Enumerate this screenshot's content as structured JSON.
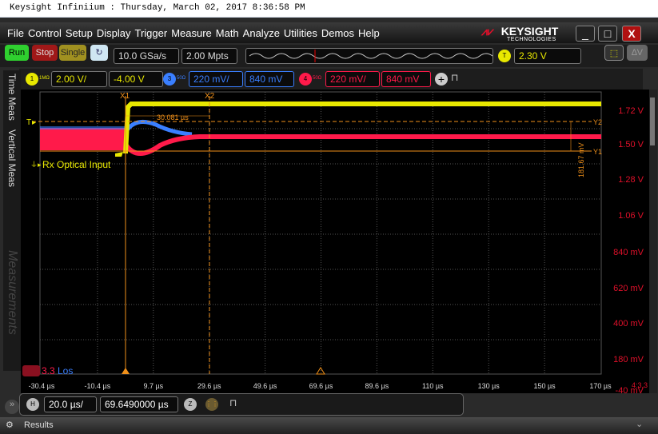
{
  "window_title": "Keysight Infiniium : Thursday, March 02, 2017 8:36:58 PM",
  "menu": [
    "File",
    "Control",
    "Setup",
    "Display",
    "Trigger",
    "Measure",
    "Math",
    "Analyze",
    "Utilities",
    "Demos",
    "Help"
  ],
  "logo": {
    "name": "KEYSIGHT",
    "sub": "TECHNOLOGIES"
  },
  "toolbar": {
    "run": "Run",
    "stop": "Stop",
    "single": "Single",
    "sample_rate": "10.0 GSa/s",
    "memory_depth": "2.00 Mpts",
    "trigger_label": "T",
    "trigger_level": "2.30 V"
  },
  "channels": [
    {
      "num": "1",
      "imp": "1MΩ",
      "scale": "2.00 V/",
      "offset": "-4.00 V",
      "color": "#e8e800"
    },
    {
      "num": "3",
      "imp": "50Ω",
      "scale": "220 mV/",
      "offset": "840 mV",
      "color": "#3a7fff"
    },
    {
      "num": "4",
      "imp": "50Ω",
      "scale": "220 mV/",
      "offset": "840 mV",
      "color": "#ff1a4a"
    }
  ],
  "side_tabs": [
    "Time Meas",
    "Vertical Meas",
    "Measurements"
  ],
  "waveform": {
    "y_labels": [
      "1.72 V",
      "1.50 V",
      "1.28 V",
      "1.06 V",
      "840 mV",
      "620 mV",
      "400 mV",
      "180 mV",
      "-40 mV"
    ],
    "x_labels": [
      "-30.4 µs",
      "-10.4 µs",
      "9.7 µs",
      "29.6 µs",
      "49.6 µs",
      "69.6 µs",
      "89.6 µs",
      "110 µs",
      "130 µs",
      "150 µs",
      "170 µs"
    ],
    "channel_label": "Rx Optical Input",
    "trigger_marker": "T",
    "cursors": {
      "x1": "X1",
      "x2": "X2",
      "y1": "Y1",
      "y2": "Y2",
      "delta_x": "30.081 µs",
      "delta_y": "181.67 mV"
    },
    "bottom_left_red": "3.3",
    "bottom_left_blue": "Los",
    "corner": "4:3.3"
  },
  "horizontal": {
    "label": "H",
    "scale": "20.0 µs/",
    "position": "69.6490000 µs"
  },
  "results": {
    "label": "Results"
  },
  "colors": {
    "ch1": "#e8e800",
    "ch3": "#3a7fff",
    "ch4": "#ff1a4a",
    "cursor": "#f0901a",
    "axis_label": "#e0102a"
  }
}
